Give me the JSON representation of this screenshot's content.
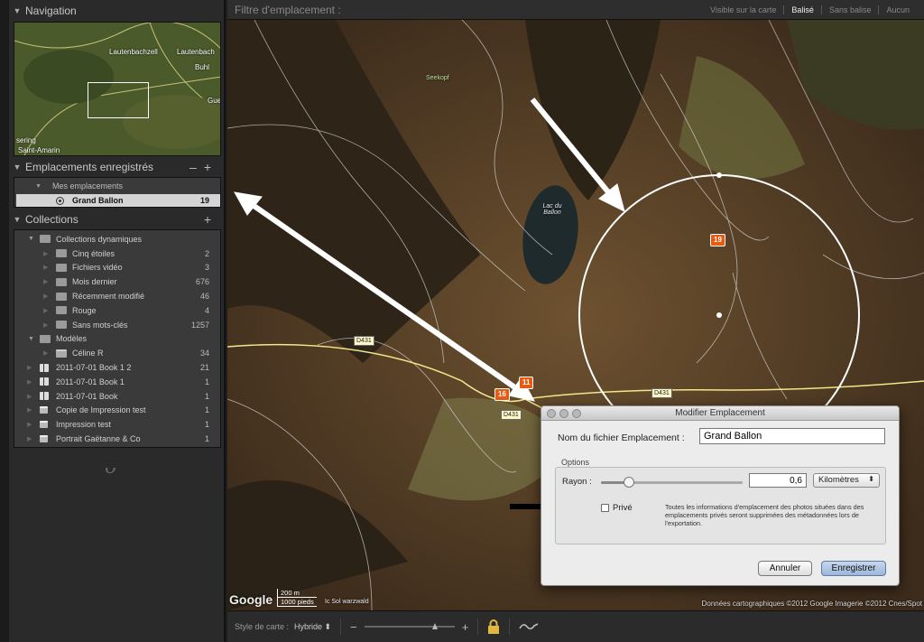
{
  "navigator": {
    "title": "Navigation",
    "map_labels": [
      "Lautenbachzell",
      "Lautenbach",
      "Buhl",
      "Gue",
      "sering",
      "Saint-Amarin"
    ]
  },
  "saved_locations": {
    "title": "Emplacements enregistrés",
    "group": "Mes emplacements",
    "items": [
      {
        "name": "Grand Ballon",
        "count": "19"
      }
    ]
  },
  "collections": {
    "title": "Collections",
    "rows": [
      {
        "type": "smart-set",
        "label": "Collections dynamiques",
        "count": ""
      },
      {
        "type": "smart",
        "label": "Cinq étoiles",
        "count": "2"
      },
      {
        "type": "smart",
        "label": "Fichiers vidéo",
        "count": "3"
      },
      {
        "type": "smart",
        "label": "Mois dernier",
        "count": "676"
      },
      {
        "type": "smart",
        "label": "Récemment modifié",
        "count": "46"
      },
      {
        "type": "smart",
        "label": "Rouge",
        "count": "4"
      },
      {
        "type": "smart",
        "label": "Sans mots-clés",
        "count": "1257"
      },
      {
        "type": "set",
        "label": "Modèles",
        "count": ""
      },
      {
        "type": "folder",
        "label": "Céline R",
        "count": "34"
      },
      {
        "type": "book",
        "label": "2011-07-01 Book 1 2",
        "count": "21"
      },
      {
        "type": "book",
        "label": "2011-07-01 Book 1",
        "count": "1"
      },
      {
        "type": "book",
        "label": "2011-07-01 Book",
        "count": "1"
      },
      {
        "type": "print",
        "label": "Copie de Impression test",
        "count": "1"
      },
      {
        "type": "print",
        "label": "Impression test",
        "count": "1"
      },
      {
        "type": "print",
        "label": "Portrait Gaëtanne & Co",
        "count": "1"
      }
    ]
  },
  "filter_bar": {
    "title": "Filtre d'emplacement :",
    "options": [
      "Visible sur la carte",
      "Balisé",
      "Sans balise",
      "Aucun"
    ],
    "active": "Balisé"
  },
  "map": {
    "labels": {
      "seekopf": "Seekopf",
      "lac": "Lac du Ballon"
    },
    "roads": [
      "D431",
      "D431",
      "D431"
    ],
    "markers": [
      "19",
      "16",
      "11"
    ],
    "google": "Google",
    "scale_m": "200 m",
    "scale_ft": "1000 pieds",
    "scale_extra": "Ic Sol warzwald",
    "copyright": "Données cartographiques ©2012 Google Imagerie ©2012 Cnes/Spot"
  },
  "dialog": {
    "title": "Modifier Emplacement",
    "name_label": "Nom du fichier Emplacement :",
    "name_value": "Grand Ballon",
    "options_label": "Options",
    "radius_label": "Rayon :",
    "radius_value": "0,6",
    "radius_slider_fraction": 0.2,
    "unit": "Kilomètres",
    "private_label": "Privé",
    "private_checked": false,
    "private_note": "Toutes les informations d'emplacement des photos situées dans des emplacements privés seront supprimées des métadonnées lors de l'exportation.",
    "cancel": "Annuler",
    "save": "Enregistrer"
  },
  "toolbar": {
    "map_style_label": "Style de carte :",
    "map_style_value": "Hybride",
    "zoom_out": "−",
    "zoom_in": "+",
    "zoom_fraction": 0.78
  }
}
